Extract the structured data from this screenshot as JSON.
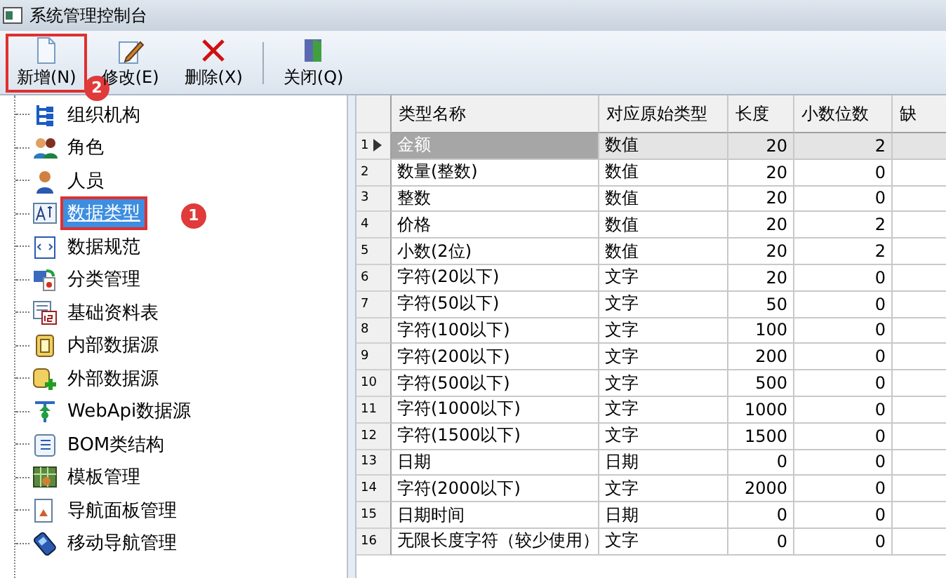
{
  "window": {
    "title": "系统管理控制台"
  },
  "toolbar": {
    "groups": [
      [
        {
          "label": "新增(N)",
          "highlighted": true,
          "badge": "2"
        },
        {
          "label": "修改(E)",
          "highlighted": false
        },
        {
          "label": "删除(X)",
          "highlighted": false
        }
      ],
      [
        {
          "label": "关闭(Q)",
          "highlighted": false
        }
      ]
    ]
  },
  "tree": {
    "items": [
      {
        "label": "组织机构",
        "selected": false,
        "highlighted": false
      },
      {
        "label": "角色",
        "selected": false,
        "highlighted": false
      },
      {
        "label": "人员",
        "selected": false,
        "highlighted": false
      },
      {
        "label": "数据类型",
        "selected": true,
        "highlighted": true,
        "badge": "1"
      },
      {
        "label": "数据规范",
        "selected": false,
        "highlighted": false
      },
      {
        "label": "分类管理",
        "selected": false,
        "highlighted": false
      },
      {
        "label": "基础资料表",
        "selected": false,
        "highlighted": false
      },
      {
        "label": "内部数据源",
        "selected": false,
        "highlighted": false
      },
      {
        "label": "外部数据源",
        "selected": false,
        "highlighted": false
      },
      {
        "label": "WebApi数据源",
        "selected": false,
        "highlighted": false
      },
      {
        "label": "BOM类结构",
        "selected": false,
        "highlighted": false
      },
      {
        "label": "模板管理",
        "selected": false,
        "highlighted": false
      },
      {
        "label": "导航面板管理",
        "selected": false,
        "highlighted": false
      },
      {
        "label": "移动导航管理",
        "selected": false,
        "highlighted": false
      }
    ]
  },
  "table": {
    "columns": [
      "类型名称",
      "对应原始类型",
      "长度",
      "小数位数",
      "缺"
    ],
    "rows": [
      {
        "number": "1",
        "selected": true,
        "cells": [
          "金额",
          "数值",
          "20",
          "2"
        ]
      },
      {
        "number": "2",
        "selected": false,
        "cells": [
          "数量(整数)",
          "数值",
          "20",
          "0"
        ]
      },
      {
        "number": "3",
        "selected": false,
        "cells": [
          "整数",
          "数值",
          "20",
          "0"
        ]
      },
      {
        "number": "4",
        "selected": false,
        "cells": [
          "价格",
          "数值",
          "20",
          "2"
        ]
      },
      {
        "number": "5",
        "selected": false,
        "cells": [
          "小数(2位)",
          "数值",
          "20",
          "2"
        ]
      },
      {
        "number": "6",
        "selected": false,
        "cells": [
          "字符(20以下)",
          "文字",
          "20",
          "0"
        ]
      },
      {
        "number": "7",
        "selected": false,
        "cells": [
          "字符(50以下)",
          "文字",
          "50",
          "0"
        ]
      },
      {
        "number": "8",
        "selected": false,
        "cells": [
          "字符(100以下)",
          "文字",
          "100",
          "0"
        ]
      },
      {
        "number": "9",
        "selected": false,
        "cells": [
          "字符(200以下)",
          "文字",
          "200",
          "0"
        ]
      },
      {
        "number": "10",
        "selected": false,
        "cells": [
          "字符(500以下)",
          "文字",
          "500",
          "0"
        ]
      },
      {
        "number": "11",
        "selected": false,
        "cells": [
          "字符(1000以下)",
          "文字",
          "1000",
          "0"
        ]
      },
      {
        "number": "12",
        "selected": false,
        "cells": [
          "字符(1500以下)",
          "文字",
          "1500",
          "0"
        ]
      },
      {
        "number": "13",
        "selected": false,
        "cells": [
          "日期",
          "日期",
          "0",
          "0"
        ]
      },
      {
        "number": "14",
        "selected": false,
        "cells": [
          "字符(2000以下)",
          "文字",
          "2000",
          "0"
        ]
      },
      {
        "number": "15",
        "selected": false,
        "cells": [
          "日期时间",
          "日期",
          "0",
          "0"
        ]
      },
      {
        "number": "16",
        "selected": false,
        "cells": [
          "无限长度字符（较少使用）",
          "文字",
          "0",
          "0"
        ]
      }
    ]
  }
}
